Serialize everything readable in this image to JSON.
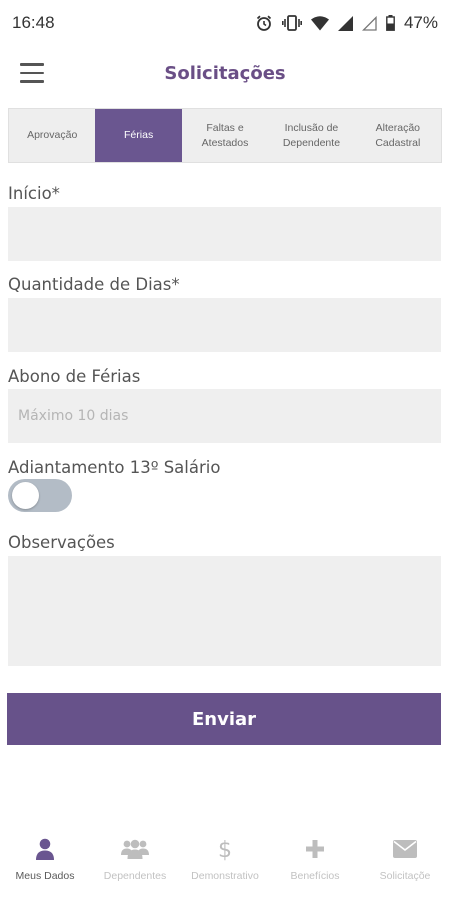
{
  "status_bar": {
    "time": "16:48",
    "battery": "47%"
  },
  "app_bar": {
    "title": "Solicitações"
  },
  "tabs": [
    {
      "label": "Aprovação",
      "active": false
    },
    {
      "label": "Férias",
      "active": true
    },
    {
      "label": "Faltas e\nAtestados",
      "active": false
    },
    {
      "label": "Inclusão de\nDependente",
      "active": false
    },
    {
      "label": "Alteração\nCadastral",
      "active": false
    }
  ],
  "form": {
    "inicio_label": "Início*",
    "inicio_value": "",
    "quantidade_label": "Quantidade de Dias*",
    "quantidade_value": "",
    "abono_label": "Abono de Férias",
    "abono_placeholder": "Máximo 10 dias",
    "adiantamento_label": "Adiantamento 13º Salário",
    "adiantamento_on": false,
    "observacoes_label": "Observações",
    "observacoes_value": "",
    "submit_label": "Enviar"
  },
  "bottom_nav": [
    {
      "label": "Meus Dados",
      "icon": "user-icon",
      "active": true
    },
    {
      "label": "Dependentes",
      "icon": "group-icon",
      "active": false
    },
    {
      "label": "Demonstrativo",
      "icon": "dollar-icon",
      "active": false
    },
    {
      "label": "Benefícios",
      "icon": "plus-icon",
      "active": false
    },
    {
      "label": "Solicitaçõe",
      "icon": "envelope-icon",
      "active": false
    }
  ],
  "colors": {
    "brand_purple": "#67528a",
    "title_purple": "#6a4f86",
    "field_bg": "#efefef",
    "toggle_off": "#b3bcc6"
  }
}
